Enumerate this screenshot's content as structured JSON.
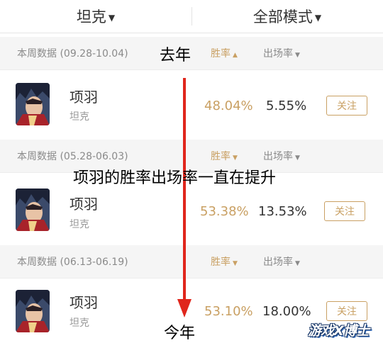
{
  "top_tabs": {
    "role_label": "坦克",
    "mode_label": "全部模式",
    "chevron": "chevron-down-icon"
  },
  "sections": [
    {
      "week_label": "本周数据 (09.28-10.04)",
      "sort_win_label": "胜率",
      "sort_app_label": "出场率",
      "hero": {
        "name": "项羽",
        "role": "坦克",
        "win_rate": "48.04%",
        "appearance_rate": "5.55%",
        "follow": "关注"
      }
    },
    {
      "week_label": "本周数据 (05.28-06.03)",
      "sort_win_label": "胜率",
      "sort_app_label": "出场率",
      "hero": {
        "name": "项羽",
        "role": "坦克",
        "win_rate": "53.38%",
        "appearance_rate": "13.53%",
        "follow": "关注"
      }
    },
    {
      "week_label": "本周数据 (06.13-06.19)",
      "sort_win_label": "胜率",
      "sort_app_label": "出场率",
      "hero": {
        "name": "项羽",
        "role": "坦克",
        "win_rate": "53.10%",
        "appearance_rate": "18.00%",
        "follow": "关注"
      }
    }
  ],
  "annotations": {
    "last_year": "去年",
    "middle": "项羽的胜率出场率一直在提升",
    "this_year": "今年"
  },
  "watermark": "游戏X博士",
  "colors": {
    "accent_gold": "#c9a063",
    "arrow_red": "#e0261c"
  }
}
